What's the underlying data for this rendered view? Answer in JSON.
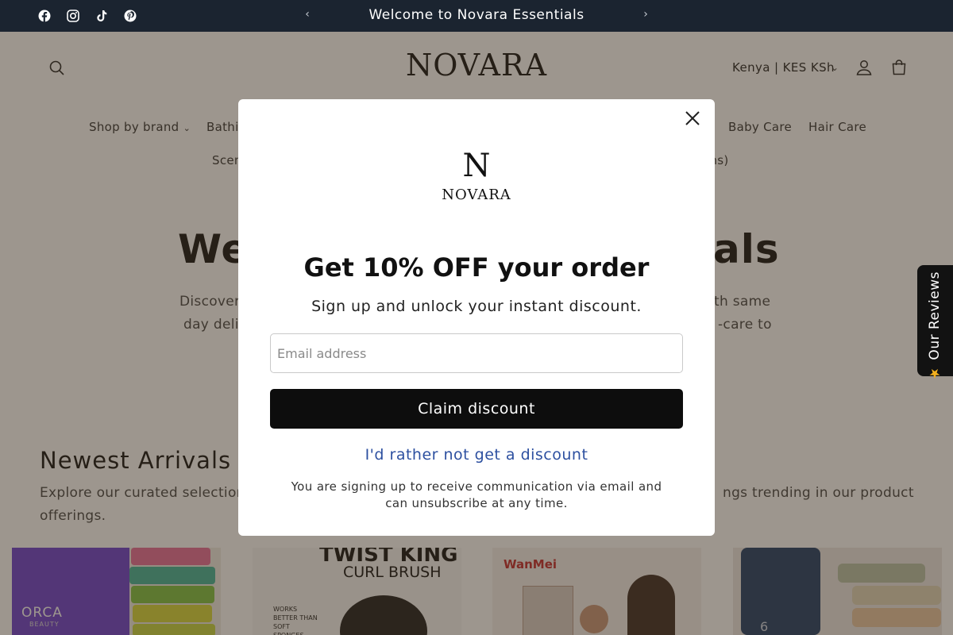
{
  "announcement": {
    "text": "Welcome to Novara Essentials",
    "social_icons": [
      "facebook-icon",
      "instagram-icon",
      "tiktok-icon",
      "pinterest-icon"
    ],
    "background": "#1b2430"
  },
  "header": {
    "logo": "NOVARA",
    "country_selector": "Kenya | KES KSh",
    "nav_items": [
      "Shop by brand",
      "Bathin",
      "Baby Care",
      "Hair Care",
      "Scen",
      "ons)"
    ]
  },
  "hero": {
    "title_left": "We",
    "title_right": "als",
    "desc_line1_left": "Discover",
    "desc_line1_right": "ith same",
    "desc_line2_left": "day deliv",
    "desc_line2_right": "-care to"
  },
  "arrivals": {
    "title": "Newest Arrivals",
    "desc_line1_left": "Explore our curated selection",
    "desc_line1_right": "ngs trending in our product",
    "desc_line2": "offerings."
  },
  "products": [
    {
      "brand_text": "ORCA",
      "sub_text": "BEAUTY"
    },
    {
      "brand_text": "TWIST KING",
      "sub_text": "CURL BRUSH",
      "detail": "WORKS BETTER THAN SOFT SPONGES, EASILY"
    },
    {
      "brand_text": "WanMei"
    },
    {
      "brand_text": "6"
    }
  ],
  "reviews_tab": {
    "label": "Our Reviews",
    "star": "★"
  },
  "modal": {
    "logo_letter": "N",
    "logo_word": "NOVARA",
    "title": "Get 10% OFF your order",
    "subtitle": "Sign up and unlock your instant discount.",
    "email_placeholder": "Email address",
    "claim_label": "Claim discount",
    "decline_label": "I'd rather not get a discount",
    "disclaimer": "You are signing up to receive communication via email and can unsubscribe at any time."
  },
  "colors": {
    "overlay": "rgba(60,45,30,0.5)",
    "link": "#2d50a0",
    "button": "#0d0d0d"
  }
}
